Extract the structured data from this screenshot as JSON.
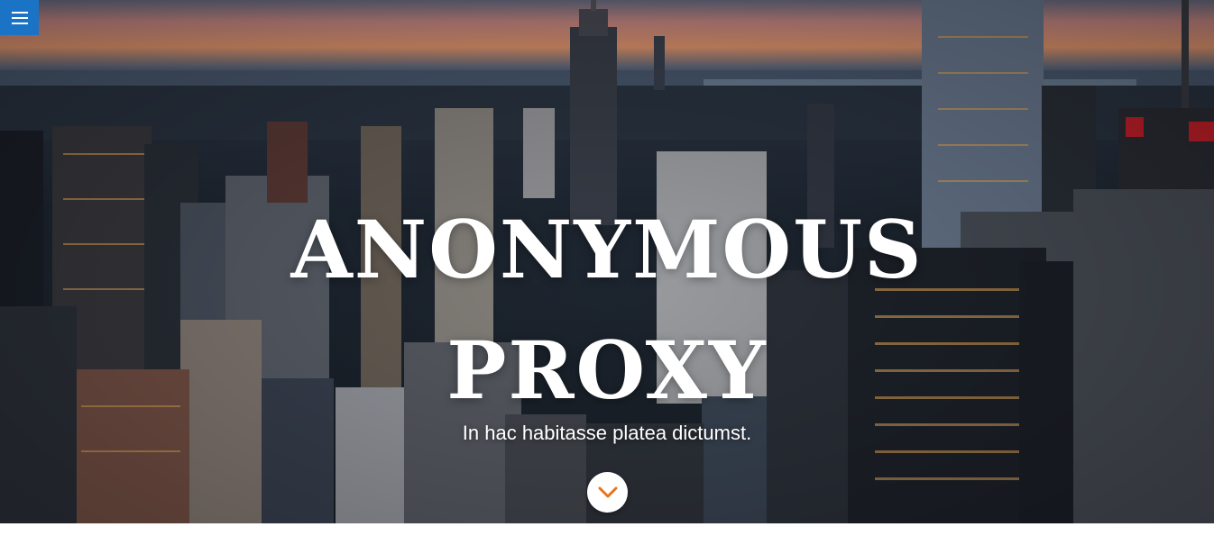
{
  "hero": {
    "title_line1": "ANONYMOUS",
    "title_line2": "PROXY",
    "tagline": "In hac habitasse platea dictumst."
  },
  "menu_button": {
    "icon": "hamburger-icon",
    "color": "#1a73c4"
  },
  "scroll_button": {
    "icon": "chevron-down-icon",
    "color": "#e8731a"
  },
  "background": {
    "description_icon": "city-skyline-image"
  }
}
